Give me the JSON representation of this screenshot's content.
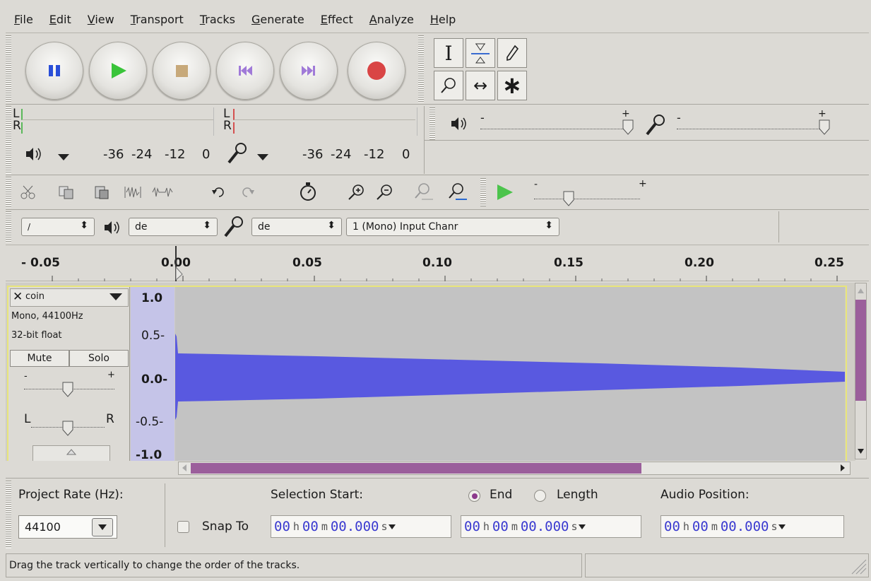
{
  "menu": [
    "File",
    "Edit",
    "View",
    "Transport",
    "Tracks",
    "Generate",
    "Effect",
    "Analyze",
    "Help"
  ],
  "transport": {
    "pause": "pause-icon",
    "play": "play-icon",
    "stop": "stop-icon",
    "skip_start": "skip-start-icon",
    "skip_end": "skip-end-icon",
    "record": "record-icon"
  },
  "tools": {
    "select": "I",
    "multi": "↔",
    "star": "∗"
  },
  "meters": {
    "playback": {
      "l": "L",
      "r": "R",
      "scale": [
        "-36",
        "-24",
        "-12",
        "0"
      ]
    },
    "record": {
      "l": "L",
      "r": "R",
      "scale": [
        "-36",
        "-24",
        "-12",
        "0"
      ]
    }
  },
  "devices": {
    "host": "/",
    "playback": "de",
    "record": "de",
    "channels": "1 (Mono) Input Chanr"
  },
  "sliders": {
    "minus": "-",
    "plus": "+"
  },
  "ruler": [
    "- 0.05",
    "0.00",
    "0.05",
    "0.10",
    "0.15",
    "0.20",
    "0.25"
  ],
  "track": {
    "name": "coin",
    "info1": "Mono, 44100Hz",
    "info2": "32-bit float",
    "mute": "Mute",
    "solo": "Solo",
    "pan_l": "L",
    "pan_r": "R",
    "yaxis": [
      "1.0",
      "0.5-",
      "0.0-",
      "-0.5-",
      "-1.0"
    ],
    "wave_color": "#5959e0"
  },
  "selection": {
    "project_rate_label": "Project Rate (Hz):",
    "project_rate": "44100",
    "snap_label": "Snap To",
    "selection_start_label": "Selection Start:",
    "end_label": "End",
    "length_label": "Length",
    "audio_position_label": "Audio Position:",
    "time": {
      "h": "00",
      "hu": "h",
      "m": "00",
      "mu": "m",
      "s": "00.000",
      "su": "s"
    }
  },
  "status": "Drag the track vertically to change the order of the tracks."
}
